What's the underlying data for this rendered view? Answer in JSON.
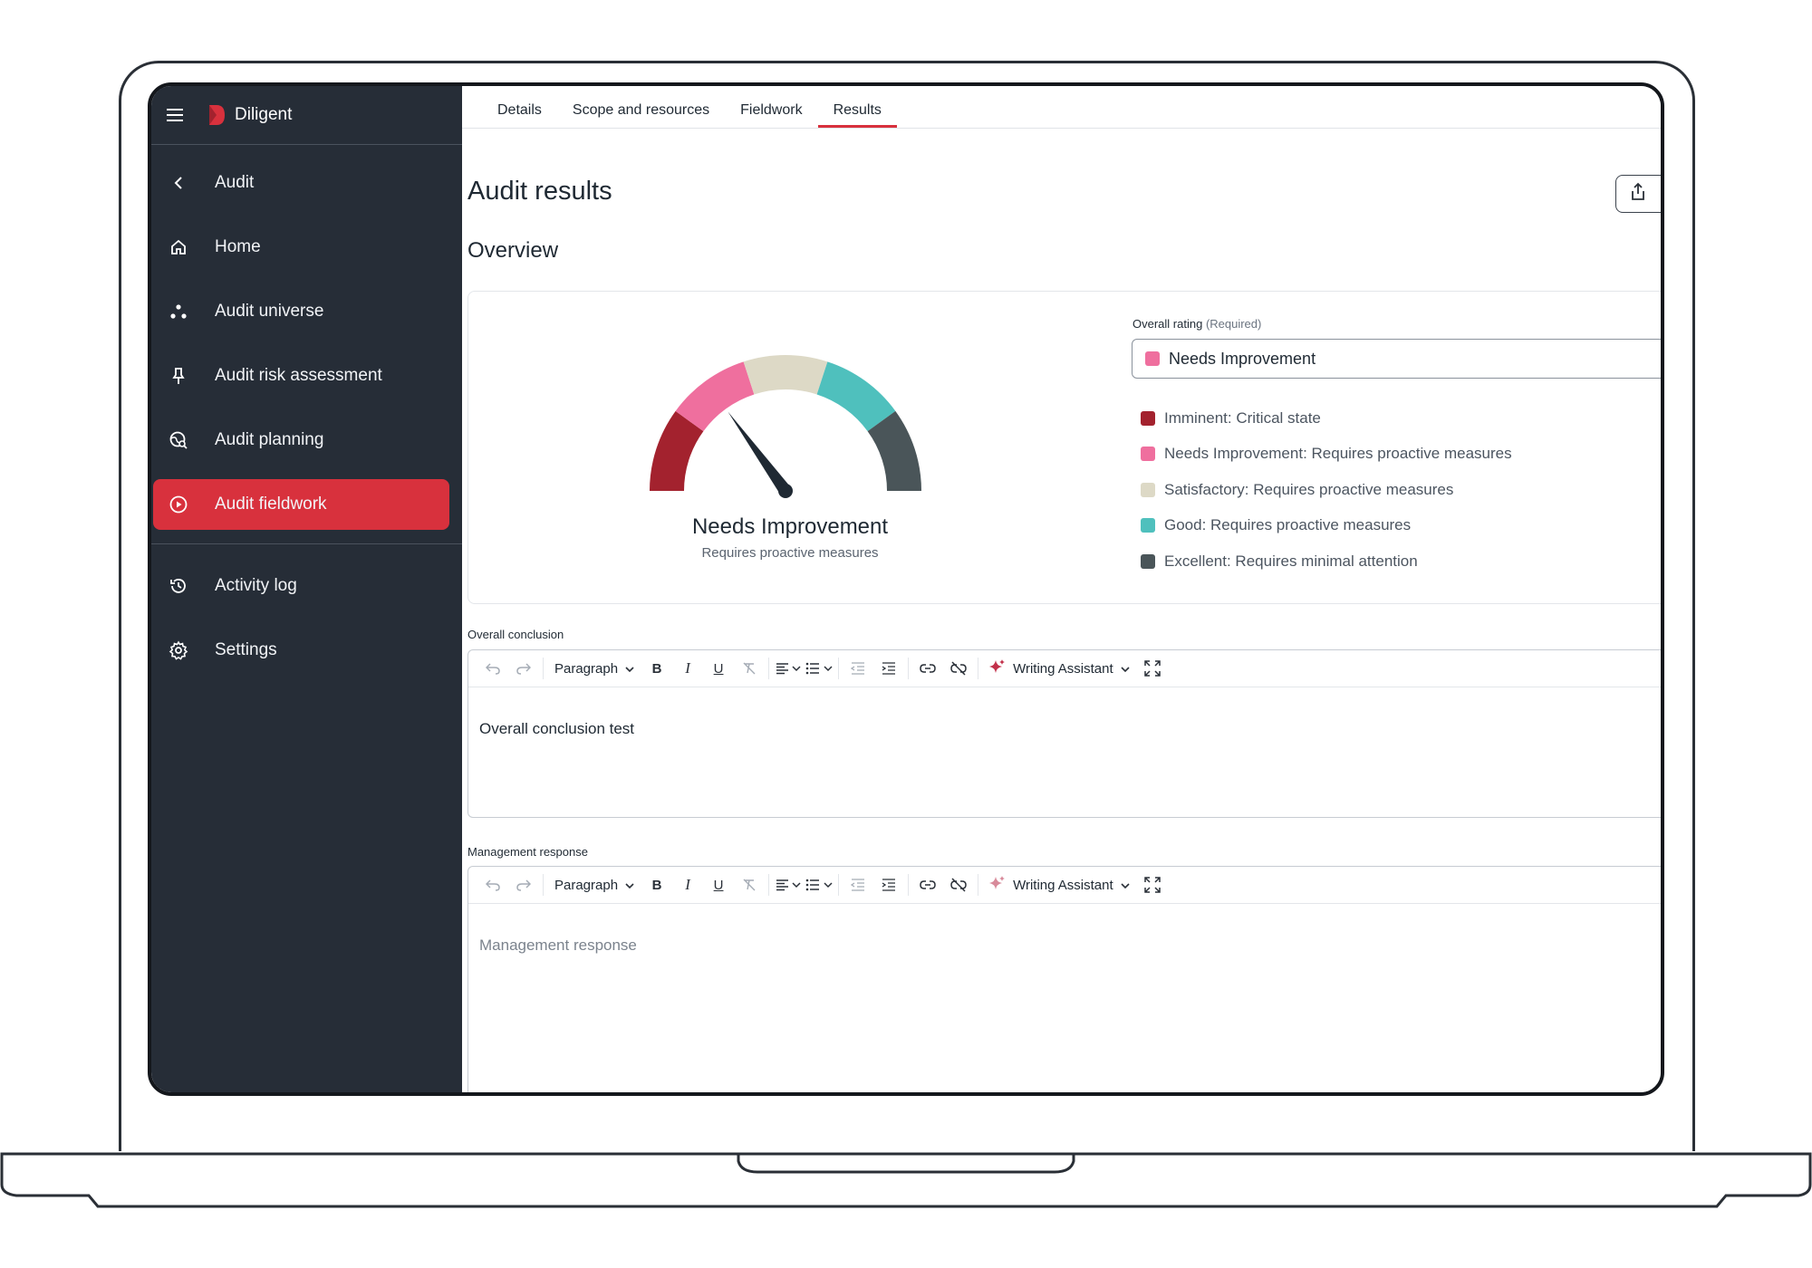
{
  "app": {
    "brand": "Diligent",
    "colors": {
      "sidebar": "#262d37",
      "accent": "#d8313d"
    }
  },
  "sidebar": {
    "back_label": "Audit",
    "items": [
      {
        "label": "Home",
        "icon": "home-icon"
      },
      {
        "label": "Audit universe",
        "icon": "universe-dots-icon"
      },
      {
        "label": "Audit risk assessment",
        "icon": "pin-icon"
      },
      {
        "label": "Audit planning",
        "icon": "globe-search-icon"
      },
      {
        "label": "Audit fieldwork",
        "icon": "play-circle-icon",
        "active": true
      }
    ],
    "footer_items": [
      {
        "label": "Activity log",
        "icon": "history-icon"
      },
      {
        "label": "Settings",
        "icon": "gear-icon"
      }
    ]
  },
  "tabs": [
    {
      "label": "Details"
    },
    {
      "label": "Scope and resources"
    },
    {
      "label": "Fieldwork"
    },
    {
      "label": "Results",
      "active": true
    }
  ],
  "page": {
    "title": "Audit results",
    "overview_title": "Overview"
  },
  "gauge": {
    "value_label": "Needs Improvement",
    "sub_label": "Requires proactive measures",
    "segments": [
      {
        "color": "#a3222e"
      },
      {
        "color": "#ef6f9e"
      },
      {
        "color": "#ddd9c6"
      },
      {
        "color": "#4fc0bd"
      },
      {
        "color": "#4a5559"
      }
    ],
    "needle_segment_index": 1
  },
  "rating": {
    "label": "Overall rating",
    "required": "(Required)",
    "selected": "Needs Improvement",
    "selected_color": "#ef6f9e",
    "legend": [
      {
        "label": "Imminent: Critical state",
        "color": "#a3222e"
      },
      {
        "label": "Needs Improvement: Requires proactive measures",
        "color": "#ef6f9e"
      },
      {
        "label": "Satisfactory: Requires proactive measures",
        "color": "#ddd9c6"
      },
      {
        "label": "Good: Requires proactive measures",
        "color": "#4fc0bd"
      },
      {
        "label": "Excellent: Requires minimal attention",
        "color": "#4a5559"
      }
    ]
  },
  "editors": {
    "conclusion": {
      "label": "Overall conclusion",
      "paragraph": "Paragraph",
      "assistant": "Writing Assistant",
      "content": "Overall conclusion test"
    },
    "management": {
      "label": "Management response",
      "paragraph": "Paragraph",
      "assistant": "Writing Assistant",
      "placeholder": "Management response"
    }
  }
}
